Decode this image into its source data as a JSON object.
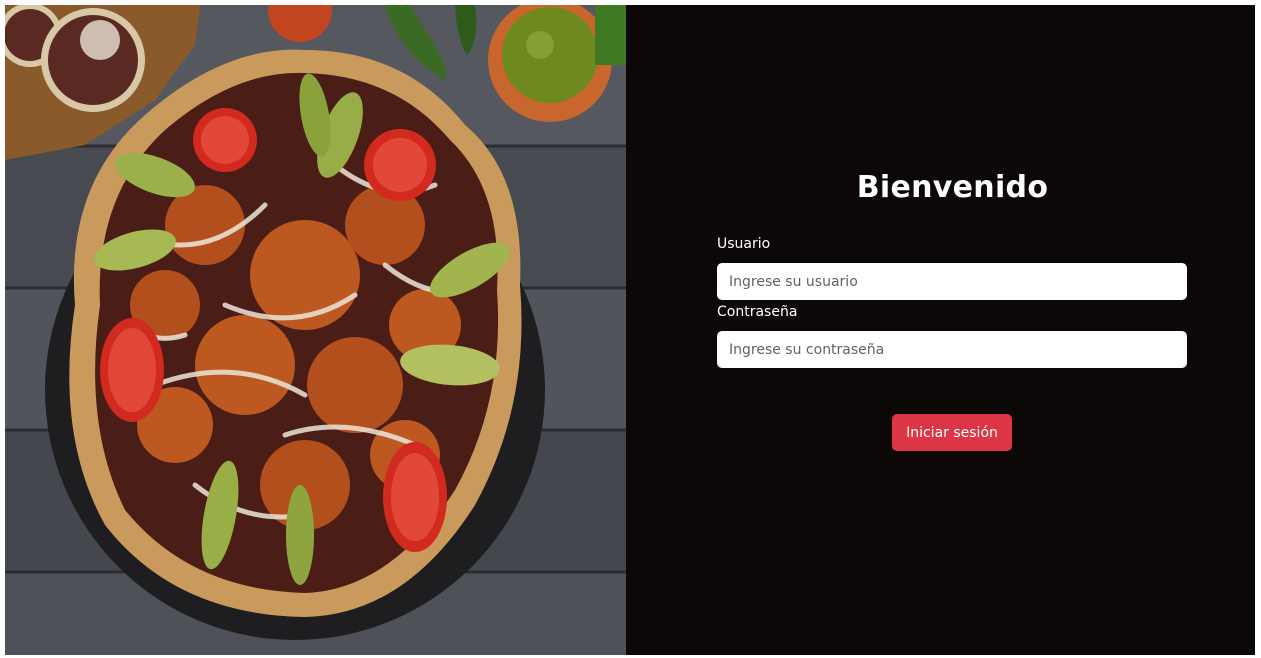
{
  "login": {
    "title": "Bienvenido",
    "username_label": "Usuario",
    "username_placeholder": "Ingrese su usuario",
    "username_value": "",
    "password_label": "Contraseña",
    "password_placeholder": "Ingrese su contraseña",
    "password_value": "",
    "submit_label": "Iniciar sesión"
  },
  "hero": {
    "icon": "food-photo"
  },
  "colors": {
    "panel_bg": "#0c0808",
    "button_bg": "#dc3545",
    "text": "#ffffff"
  }
}
